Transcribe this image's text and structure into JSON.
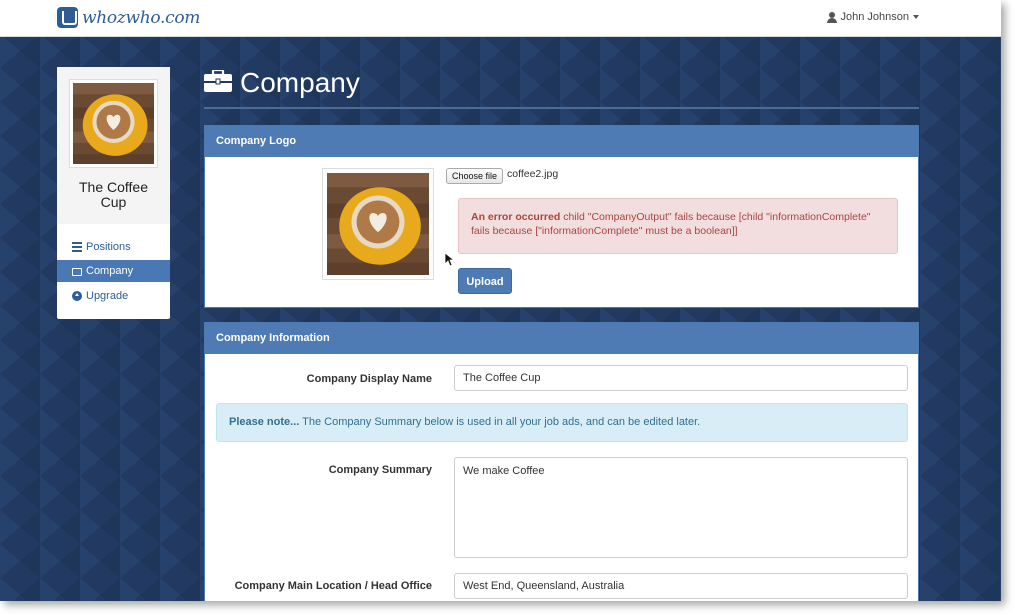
{
  "navbar": {
    "brand": "whozwho.com",
    "user_name": "John Johnson"
  },
  "sidebar": {
    "company_name": "The Coffee Cup",
    "items": [
      {
        "label": "Positions",
        "icon": "list-icon"
      },
      {
        "label": "Company",
        "icon": "briefcase-icon",
        "active": true
      },
      {
        "label": "Upgrade",
        "icon": "upgrade-icon"
      }
    ]
  },
  "page": {
    "title": "Company"
  },
  "logo_panel": {
    "heading": "Company Logo",
    "choose_file_label": "Choose file",
    "file_name": "coffee2.jpg",
    "error_strong": "An error occurred",
    "error_text": " child \"CompanyOutput\" fails because [child \"informationComplete\" fails because [\"informationComplete\" must be a boolean]]",
    "upload_label": "Upload"
  },
  "info_panel": {
    "heading": "Company Information",
    "display_name_label": "Company Display Name",
    "display_name_value": "The Coffee Cup",
    "note_strong": "Please note...",
    "note_text": " The Company Summary below is used in all your job ads, and can be edited later.",
    "summary_label": "Company Summary",
    "summary_value": "We make Coffee",
    "location_label": "Company Main Location / Head Office",
    "location_value": "West End, Queensland, Australia"
  },
  "colors": {
    "background": "#223a61",
    "panel_heading": "#4f7bb4",
    "error_bg": "#f2dede",
    "info_bg": "#d9edf7"
  }
}
